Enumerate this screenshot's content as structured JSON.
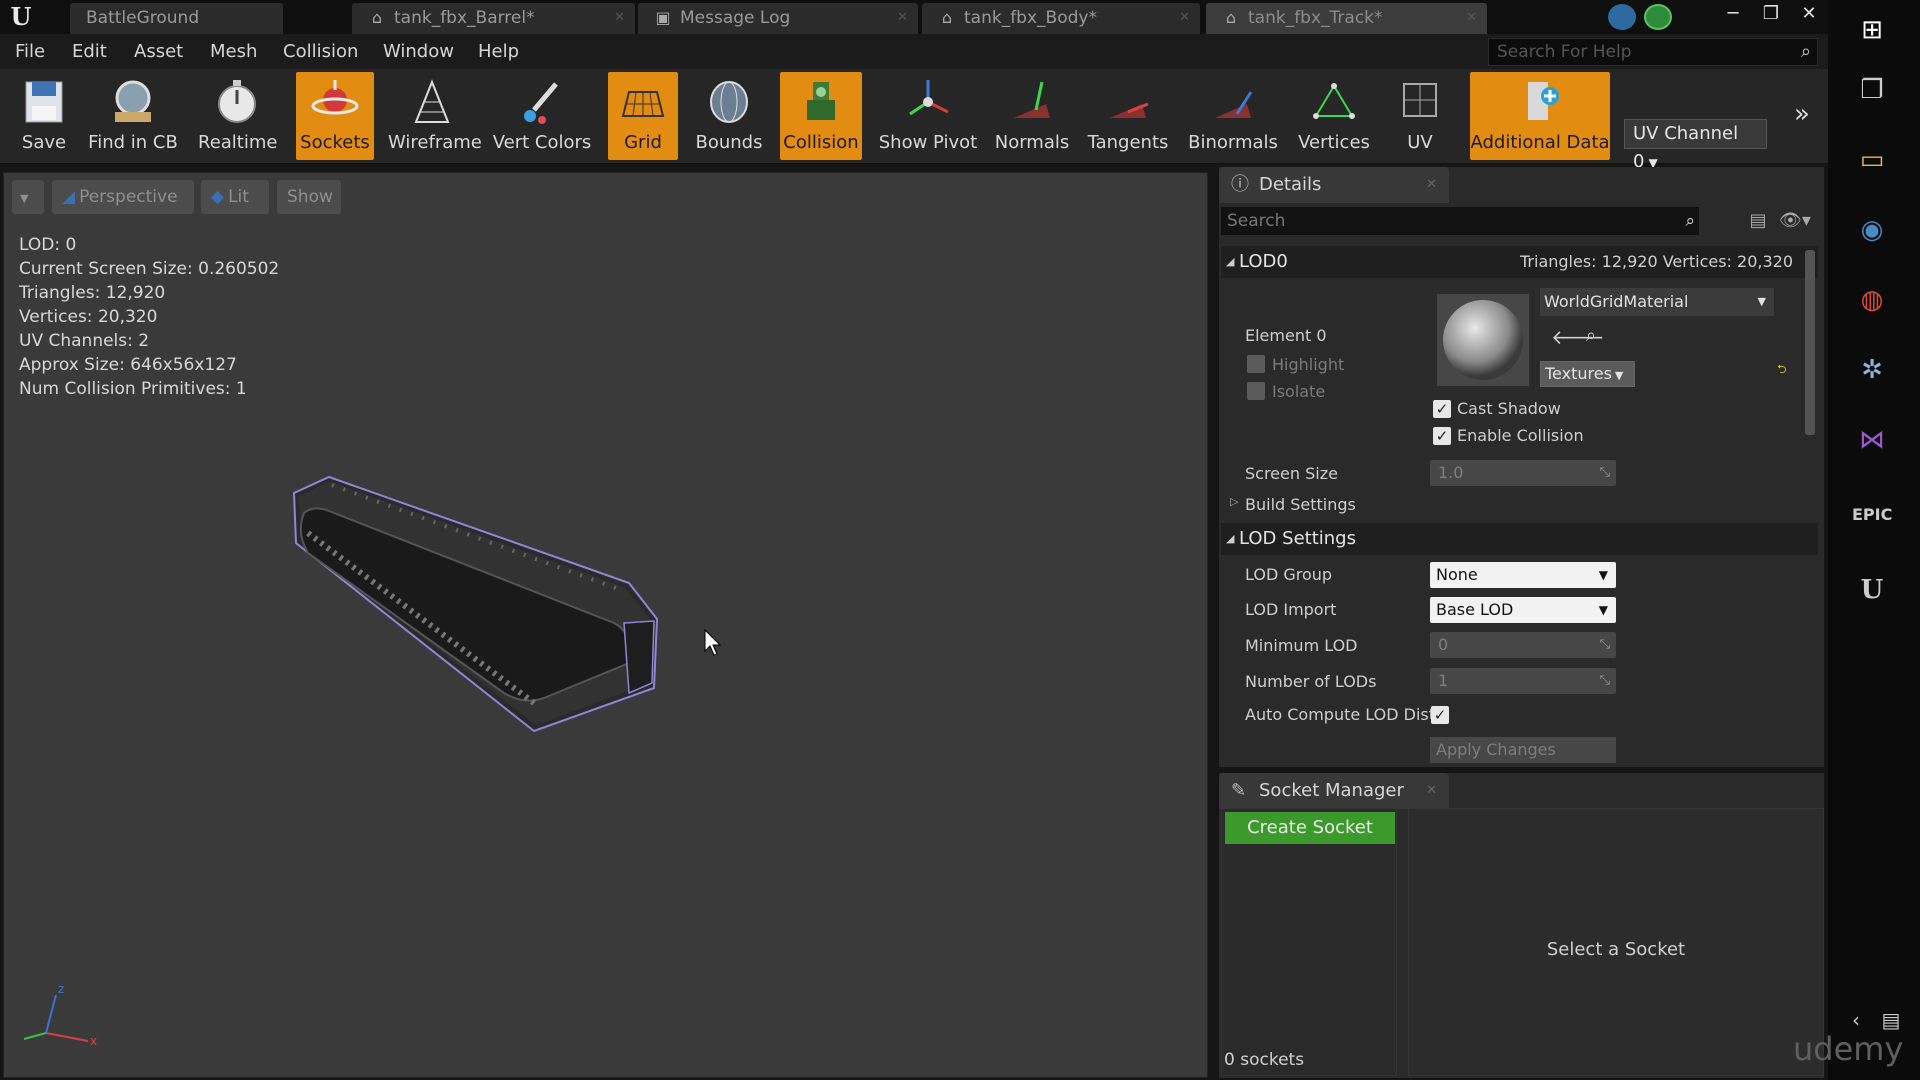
{
  "app": {
    "open_tabs": [
      {
        "label": "BattleGround",
        "icon": "level-icon"
      },
      {
        "label": "tank_fbx_Barrel*",
        "icon": "static-mesh-icon"
      },
      {
        "label": "Message Log",
        "icon": "message-log-icon"
      },
      {
        "label": "tank_fbx_Body*",
        "icon": "static-mesh-icon"
      },
      {
        "label": "tank_fbx_Track*",
        "icon": "static-mesh-icon"
      }
    ],
    "active_tab_index": 4
  },
  "menu": {
    "items": [
      "File",
      "Edit",
      "Asset",
      "Mesh",
      "Collision",
      "Window",
      "Help"
    ],
    "help_search_placeholder": "Search For Help"
  },
  "toolbar": {
    "buttons": [
      {
        "label": "Save",
        "icon": "save-icon",
        "active": false
      },
      {
        "label": "Find in CB",
        "icon": "find-in-cb-icon",
        "active": false
      },
      {
        "label": "Realtime",
        "icon": "realtime-icon",
        "active": false
      },
      {
        "label": "Sockets",
        "icon": "sockets-icon",
        "active": true
      },
      {
        "label": "Wireframe",
        "icon": "wireframe-icon",
        "active": false
      },
      {
        "label": "Vert Colors",
        "icon": "vert-colors-icon",
        "active": false
      },
      {
        "label": "Grid",
        "icon": "grid-icon",
        "active": true
      },
      {
        "label": "Bounds",
        "icon": "bounds-icon",
        "active": false
      },
      {
        "label": "Collision",
        "icon": "collision-icon",
        "active": true
      },
      {
        "label": "Show Pivot",
        "icon": "show-pivot-icon",
        "active": false
      },
      {
        "label": "Normals",
        "icon": "normals-icon",
        "active": false
      },
      {
        "label": "Tangents",
        "icon": "tangents-icon",
        "active": false
      },
      {
        "label": "Binormals",
        "icon": "binormals-icon",
        "active": false
      },
      {
        "label": "Vertices",
        "icon": "vertices-icon",
        "active": false
      },
      {
        "label": "UV",
        "icon": "uv-icon",
        "active": false
      },
      {
        "label": "Additional Data",
        "icon": "additional-data-icon",
        "active": true
      }
    ],
    "uv_channel": "UV Channel 0"
  },
  "viewport": {
    "perspective_label": "Perspective",
    "lit_label": "Lit",
    "show_label": "Show",
    "stats": [
      "LOD:  0",
      "Current Screen Size:  0.260502",
      "Triangles:  12,920",
      "Vertices:  20,320",
      "UV Channels:  2",
      "Approx Size: 646x56x127",
      "Num Collision Primitives:  1"
    ]
  },
  "details": {
    "tab_label": "Details",
    "search_placeholder": "Search",
    "lod0": {
      "header": "LOD0",
      "summary": "Triangles: 12,920   Vertices: 20,320",
      "element_label": "Element 0",
      "highlight_label": "Highlight",
      "isolate_label": "Isolate",
      "material_name": "WorldGridMaterial",
      "textures_label": "Textures",
      "cast_shadow_label": "Cast Shadow",
      "enable_collision_label": "Enable Collision",
      "screen_size_label": "Screen Size",
      "screen_size_value": "1.0",
      "build_settings_label": "Build Settings"
    },
    "lod_settings": {
      "header": "LOD Settings",
      "lod_group_label": "LOD Group",
      "lod_group_value": "None",
      "lod_import_label": "LOD Import",
      "lod_import_value": "Base LOD",
      "minimum_lod_label": "Minimum LOD",
      "minimum_lod_value": "0",
      "number_of_lods_label": "Number of LODs",
      "number_of_lods_value": "1",
      "auto_compute_label": "Auto Compute LOD Dist",
      "apply_label": "Apply Changes"
    }
  },
  "socket_manager": {
    "tab_label": "Socket Manager",
    "create_label": "Create Socket",
    "empty_label": "Select a Socket",
    "count_label": "0 sockets"
  },
  "taskbar": {
    "icons": [
      "windows-start-icon",
      "task-view-icon",
      "file-explorer-icon",
      "steam-icon",
      "chrome-icon",
      "app-icon",
      "visual-studio-icon",
      "epic-games-icon",
      "unreal-engine-icon"
    ]
  },
  "watermark": "udemy",
  "colors": {
    "toolbar_active": "#e38c12",
    "create_socket_green": "#3c9a2c",
    "viewport_bg": "#3a3a3a"
  }
}
